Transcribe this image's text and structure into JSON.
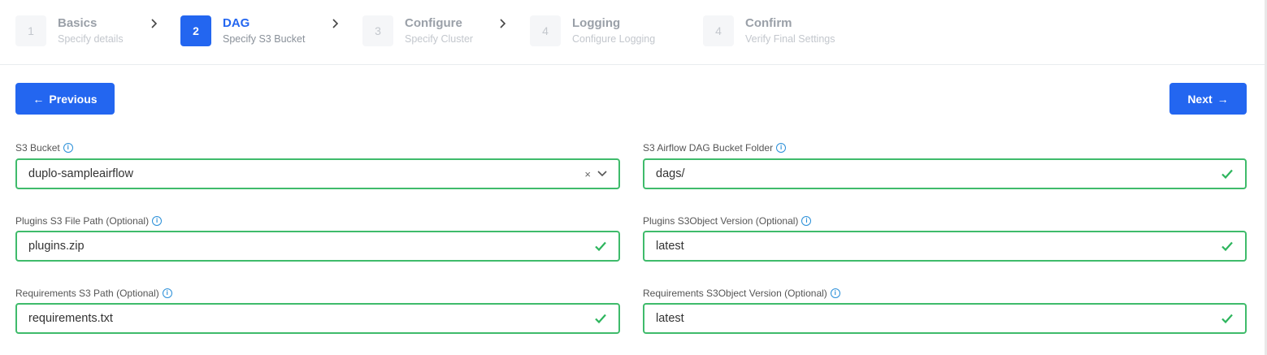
{
  "steps": [
    {
      "num": "1",
      "title": "Basics",
      "sub": "Specify details"
    },
    {
      "num": "2",
      "title": "DAG",
      "sub": "Specify S3 Bucket"
    },
    {
      "num": "3",
      "title": "Configure",
      "sub": "Specify Cluster"
    },
    {
      "num": "4",
      "title": "Logging",
      "sub": "Configure Logging"
    },
    {
      "num": "4",
      "title": "Confirm",
      "sub": "Verify Final Settings"
    }
  ],
  "buttons": {
    "previous": "Previous",
    "next": "Next"
  },
  "fields": {
    "s3_bucket": {
      "label": "S3 Bucket",
      "value": "duplo-sampleairflow"
    },
    "dag_folder": {
      "label": "S3 Airflow DAG Bucket Folder",
      "value": "dags/"
    },
    "plugins_path": {
      "label": "Plugins S3 File Path (Optional)",
      "value": "plugins.zip"
    },
    "plugins_version": {
      "label": "Plugins S3Object Version (Optional)",
      "value": "latest"
    },
    "req_path": {
      "label": "Requirements S3 Path (Optional)",
      "value": "requirements.txt"
    },
    "req_version": {
      "label": "Requirements S3Object Version (Optional)",
      "value": "latest"
    }
  },
  "colors": {
    "primary": "#2366f0",
    "valid": "#3fbb6b",
    "info": "#2a8fd8"
  }
}
